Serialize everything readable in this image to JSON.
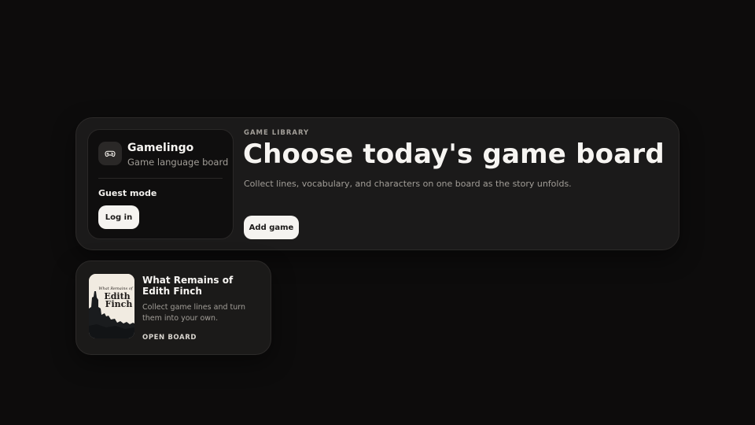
{
  "app": {
    "name": "Gamelingo",
    "subtitle": "Game language board",
    "icon": "gamepad-icon"
  },
  "account": {
    "mode_label": "Guest mode",
    "login_label": "Log in"
  },
  "hero": {
    "eyebrow": "GAME LIBRARY",
    "title": "Choose today's game board",
    "subtitle": "Collect lines, vocabulary, and characters on one board as the story unfolds.",
    "add_label": "Add game"
  },
  "games": [
    {
      "title": "What Remains of Edith Finch",
      "description": "Collect game lines and turn them into your own.",
      "action_label": "OPEN BOARD",
      "cover": {
        "small_text": "What Remains of",
        "line1": "Edith",
        "line2": "Finch"
      }
    }
  ],
  "colors": {
    "background": "#0d0c0c",
    "panel": "#1b1a1a",
    "button": "#f5f3f0",
    "muted_text": "#a29e98"
  }
}
